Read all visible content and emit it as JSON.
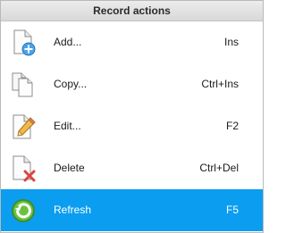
{
  "menu": {
    "header": "Record actions",
    "items": [
      {
        "label": "Add...",
        "shortcut": "Ins",
        "icon": "add-document-icon"
      },
      {
        "label": "Copy...",
        "shortcut": "Ctrl+Ins",
        "icon": "copy-documents-icon"
      },
      {
        "label": "Edit...",
        "shortcut": "F2",
        "icon": "edit-pencil-icon"
      },
      {
        "label": "Delete",
        "shortcut": "Ctrl+Del",
        "icon": "delete-document-icon"
      },
      {
        "label": "Refresh",
        "shortcut": "F5",
        "icon": "refresh-icon"
      }
    ],
    "selected_index": 4,
    "colors": {
      "selection": "#0a9df0",
      "header_bg": "#e0e0e0"
    }
  }
}
